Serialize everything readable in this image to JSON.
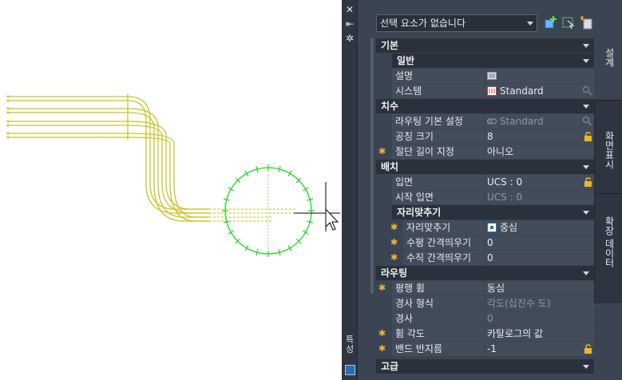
{
  "palette": {
    "selection": "선택 요소가 없습니다",
    "title": "특성",
    "sections": {
      "basic": "기본",
      "general": "일반",
      "dimensions": "치수",
      "placement": "배치",
      "snap": "자리맞추기",
      "routing": "라우팅",
      "advanced": "고급"
    },
    "rows": {
      "description": {
        "label": "설명",
        "value": ""
      },
      "system": {
        "label": "시스템",
        "value": "Standard"
      },
      "routing_pref": {
        "label": "라우팅 기본 설정",
        "value": "Standard"
      },
      "nominal_size": {
        "label": "공칭 크기",
        "value": "8"
      },
      "cut_length": {
        "label": "절단 길이 지정",
        "value": "아니오"
      },
      "elevation": {
        "label": "입면",
        "value": "UCS : 0"
      },
      "start_elevation": {
        "label": "시작 입면",
        "value": "UCS : 0"
      },
      "justification": {
        "label": "자리맞추기",
        "value": "중심"
      },
      "h_offset": {
        "label": "수평 간격띄우기",
        "value": "0"
      },
      "v_offset": {
        "label": "수직 간격띄우기",
        "value": "0"
      },
      "parallel_bend": {
        "label": "평행 휨",
        "value": "동심"
      },
      "slope_format": {
        "label": "경사 형식",
        "value": "각도(십진수 도)"
      },
      "slope": {
        "label": "경사",
        "value": "0"
      },
      "bend_angle": {
        "label": "휨 각도",
        "value": "카탈로그의 값"
      },
      "bend_radius": {
        "label": "밴드 반지름",
        "value": "-1"
      }
    },
    "tabs": [
      "설계",
      "화면표시",
      "확장 데이터"
    ]
  },
  "colors": {
    "pipe": "#c9c22e",
    "snap_circle": "#1fd41f",
    "panel": "#3b4453",
    "header": "#2b313b",
    "star": "#f2b233"
  }
}
